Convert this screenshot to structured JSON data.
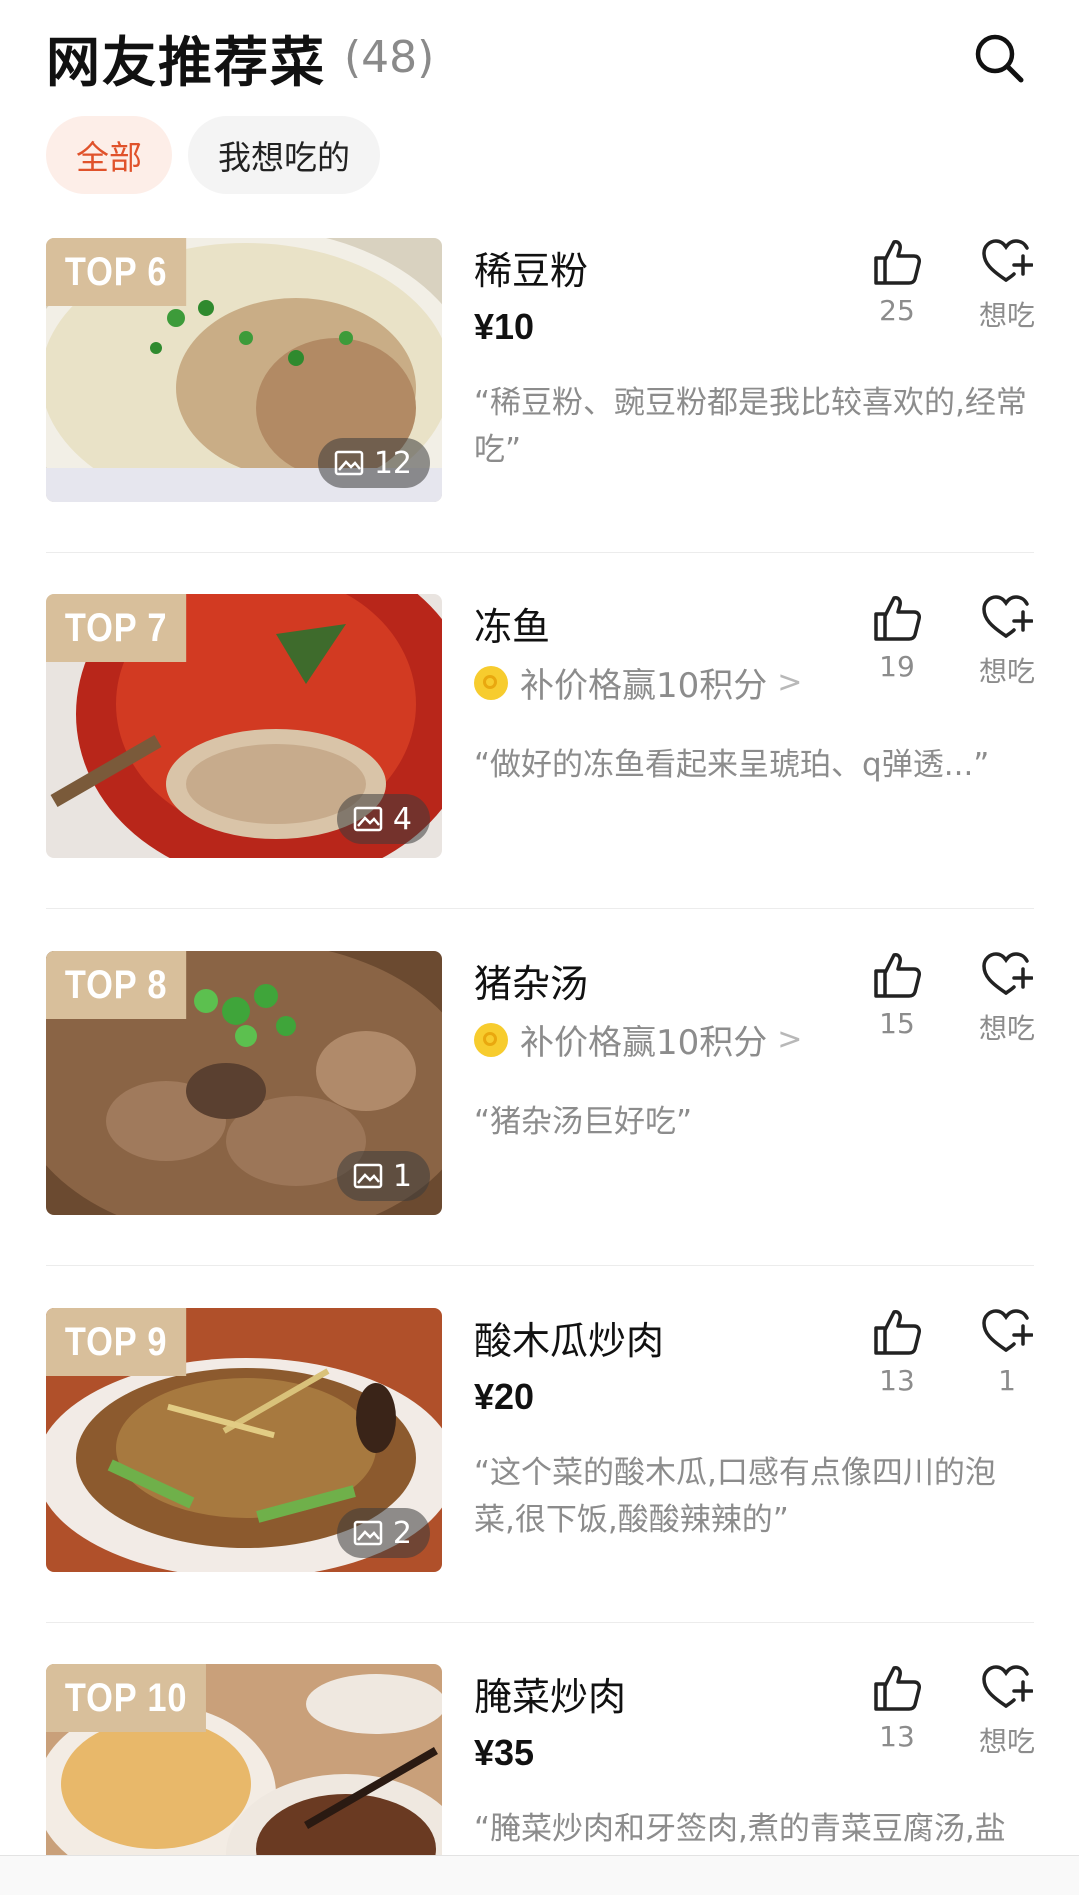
{
  "header": {
    "title": "网友推荐菜",
    "count": "(48)"
  },
  "filters": [
    {
      "label": "全部",
      "active": true
    },
    {
      "label": "我想吃的",
      "active": false
    }
  ],
  "dishes": [
    {
      "rank": "TOP 6",
      "name": "稀豆粉",
      "price": "¥10",
      "reward": null,
      "likes": "25",
      "want_label": "想吃",
      "photos": "12",
      "quote": "“稀豆粉、豌豆粉都是我比较喜欢的,经常吃”"
    },
    {
      "rank": "TOP 7",
      "name": "冻鱼",
      "price": null,
      "reward": "补价格赢10积分",
      "likes": "19",
      "want_label": "想吃",
      "photos": "4",
      "quote": "“做好的冻鱼看起来呈琥珀、q弹透...”"
    },
    {
      "rank": "TOP 8",
      "name": "猪杂汤",
      "price": null,
      "reward": "补价格赢10积分",
      "likes": "15",
      "want_label": "想吃",
      "photos": "1",
      "quote": "“猪杂汤巨好吃”"
    },
    {
      "rank": "TOP 9",
      "name": "酸木瓜炒肉",
      "price": "¥20",
      "reward": null,
      "likes": "13",
      "want_label": "1",
      "photos": "2",
      "quote": "“这个菜的酸木瓜,口感有点像四川的泡菜,很下饭,酸酸辣辣的”"
    },
    {
      "rank": "TOP 10",
      "name": "腌菜炒肉",
      "price": "¥35",
      "reward": null,
      "likes": "13",
      "want_label": "想吃",
      "photos": null,
      "quote": "“腌菜炒肉和牙签肉,煮的青菜豆腐汤,盐"
    }
  ],
  "colors": {
    "accent": "#e0522b",
    "rank_badge": "#d8bf9b",
    "coin": "#f7cc2e",
    "muted_text": "#8c8c8c"
  },
  "icons": {
    "search": "search-icon",
    "like": "thumbs-up-icon",
    "want": "heart-plus-icon",
    "photo": "image-icon",
    "coin": "coin-icon"
  }
}
